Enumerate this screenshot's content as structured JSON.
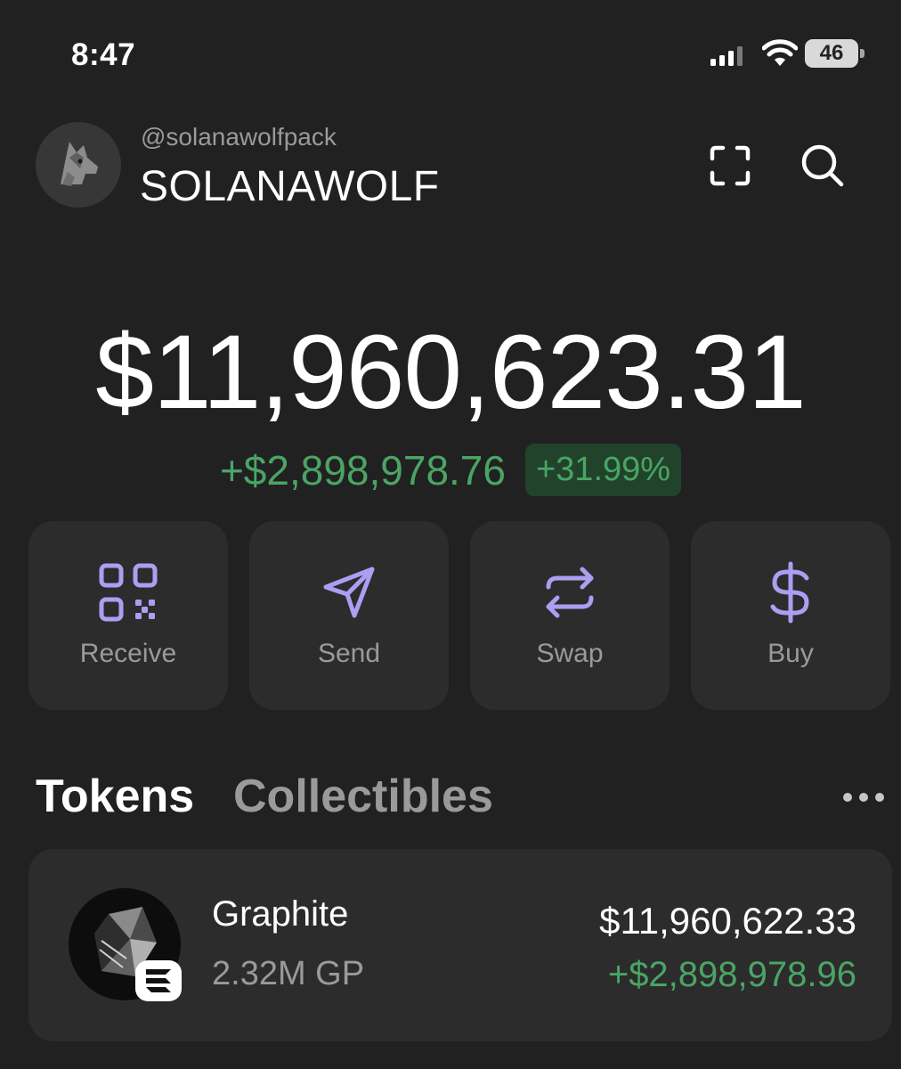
{
  "status_bar": {
    "time": "8:47",
    "battery": "46",
    "icons": [
      "signal-icon",
      "wifi-icon",
      "battery-icon"
    ]
  },
  "header": {
    "handle": "@solanawolfpack",
    "username": "SOLANAWOLF",
    "avatar_icon": "wolf-avatar",
    "buttons": [
      "scan-icon",
      "search-icon"
    ]
  },
  "balance": {
    "total": "$11,960,623.31",
    "change_amount": "+$2,898,978.76",
    "change_percent": "+31.99%"
  },
  "actions": [
    {
      "label": "Receive",
      "icon": "qr-code-icon"
    },
    {
      "label": "Send",
      "icon": "send-icon"
    },
    {
      "label": "Swap",
      "icon": "swap-icon"
    },
    {
      "label": "Buy",
      "icon": "dollar-icon"
    }
  ],
  "tabs": {
    "tokens": "Tokens",
    "collectibles": "Collectibles",
    "active": "Tokens"
  },
  "tokens": [
    {
      "name": "Graphite",
      "amount": "2.32M GP",
      "value": "$11,960,622.33",
      "change": "+$2,898,978.96",
      "icon": "graphite-token-icon"
    }
  ],
  "colors": {
    "background": "#222122",
    "card": "#2d2c2d",
    "accent": "#ab9ff2",
    "positive": "#4aa565",
    "muted_text": "#9b9a9b"
  }
}
